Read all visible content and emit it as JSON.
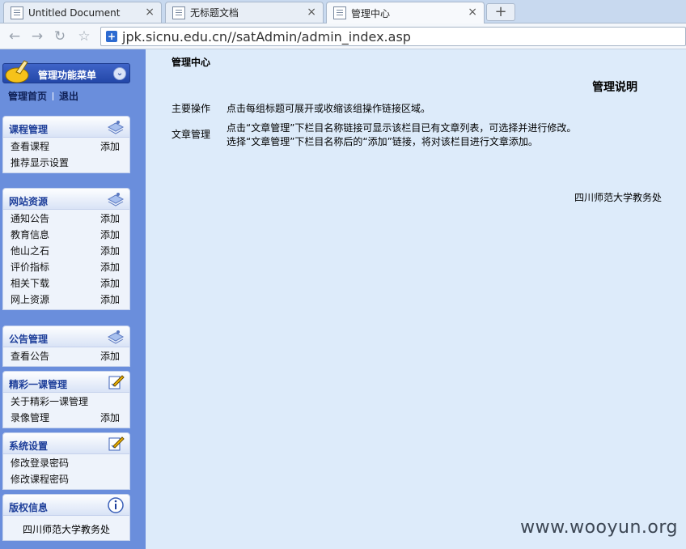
{
  "browser": {
    "tabs": [
      {
        "title": "Untitled Document",
        "active": false
      },
      {
        "title": "无标题文档",
        "active": false
      },
      {
        "title": "管理中心",
        "active": true
      }
    ],
    "newtab_label": "+",
    "close_glyph": "×",
    "url": "jpk.sicnu.edu.cn//satAdmin/admin_index.asp"
  },
  "sidebar": {
    "menu_title": "管理功能菜单",
    "toggle_glyph": "⌄",
    "home_label": "管理首页",
    "logout_label": "退出",
    "groups": [
      {
        "title": "课程管理",
        "icon": "stack-icon",
        "items": [
          {
            "label": "查看课程",
            "action": "添加"
          },
          {
            "label": "推荐显示设置",
            "action": ""
          }
        ]
      },
      {
        "title": "网站资源",
        "icon": "stack-icon",
        "items": [
          {
            "label": "通知公告",
            "action": "添加"
          },
          {
            "label": "教育信息",
            "action": "添加"
          },
          {
            "label": "他山之石",
            "action": "添加"
          },
          {
            "label": "评价指标",
            "action": "添加"
          },
          {
            "label": "相关下载",
            "action": "添加"
          },
          {
            "label": "网上资源",
            "action": "添加"
          }
        ]
      },
      {
        "title": "公告管理",
        "icon": "stack-icon",
        "items": [
          {
            "label": "查看公告",
            "action": "添加"
          }
        ]
      },
      {
        "title": "精彩一课管理",
        "icon": "edit-icon",
        "items": [
          {
            "label": "关于精彩一课管理",
            "action": ""
          },
          {
            "label": "录像管理",
            "action": "添加"
          }
        ]
      },
      {
        "title": "系统设置",
        "icon": "edit-icon",
        "items": [
          {
            "label": "修改登录密码",
            "action": ""
          },
          {
            "label": "修改课程密码",
            "action": ""
          }
        ]
      },
      {
        "title": "版权信息",
        "icon": "info-icon",
        "text": "四川师范大学教务处"
      }
    ]
  },
  "content": {
    "page_title": "管理中心",
    "heading": "管理说明",
    "rows": [
      {
        "label": "主要操作",
        "lines": [
          "点击每组标题可展开或收缩该组操作链接区域。"
        ]
      },
      {
        "label": "文章管理",
        "lines": [
          "点击“文章管理”下栏目名称链接可显示该栏目已有文章列表，可选择并进行修改。",
          "选择“文章管理”下栏目名称后的“添加”链接，将对该栏目进行文章添加。"
        ]
      }
    ],
    "footer": "四川师范大学教务处"
  },
  "watermark": "www.wooyun.org",
  "colors": {
    "sidebar": "#6a8edc",
    "content_bg": "#ddebfa",
    "group_title": "#1e3f9a"
  }
}
